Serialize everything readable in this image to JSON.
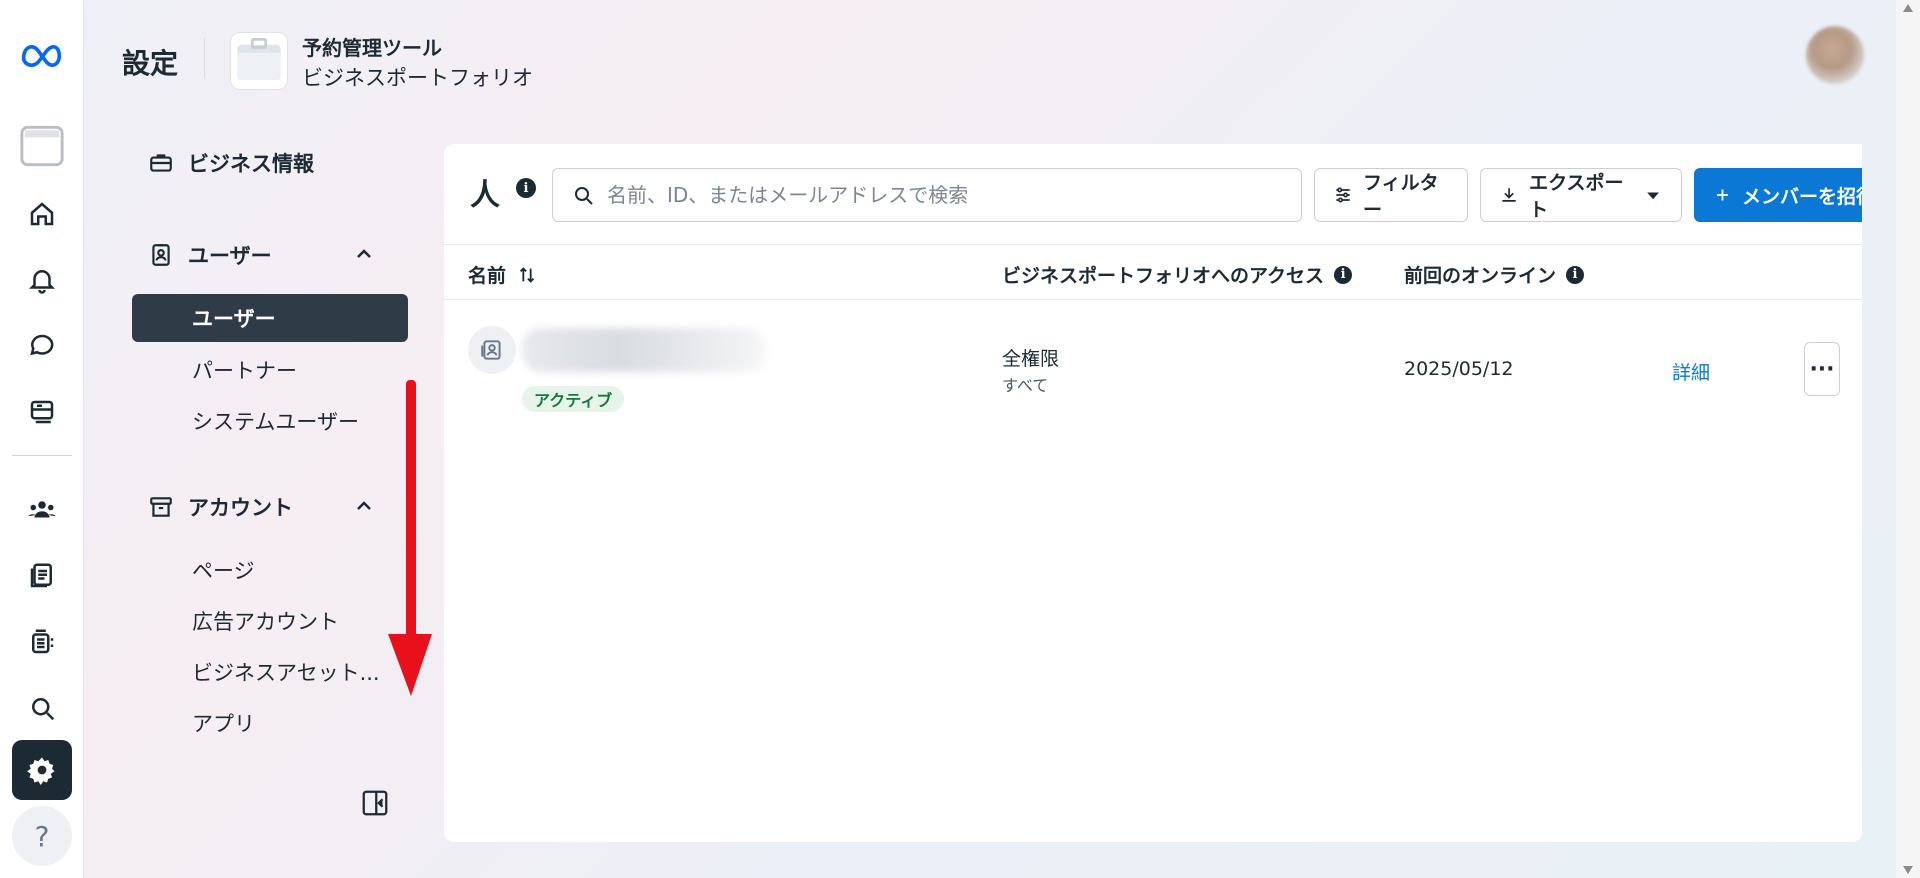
{
  "header": {
    "title": "設定",
    "portfolio_name": "予約管理ツール",
    "portfolio_sub": "ビジネスポートフォリオ"
  },
  "rail": {
    "icons": [
      "meta-logo-icon",
      "portfolio-icon",
      "home-icon",
      "bell-icon",
      "chat-icon",
      "inbox-icon",
      "people-icon",
      "documents-icon",
      "ads-icon",
      "search-icon",
      "settings-icon",
      "help-icon"
    ],
    "help_label": "?"
  },
  "sidebar": {
    "business_info": "ビジネス情報",
    "users_section": "ユーザー",
    "users_items": [
      "ユーザー",
      "パートナー",
      "システムユーザー"
    ],
    "accounts_section": "アカウント",
    "accounts_items": [
      "ページ",
      "広告アカウント",
      "ビジネスアセット...",
      "アプリ"
    ]
  },
  "main": {
    "title": "人",
    "search_placeholder": "名前、ID、またはメールアドレスで検索",
    "filter_label": "フィルター",
    "export_label": "エクスポート",
    "invite_label": "メンバーを招待",
    "columns": {
      "name": "名前",
      "access": "ビジネスポートフォリオへのアクセス",
      "last_online": "前回のオンライン"
    },
    "rows": [
      {
        "status": "アクティブ",
        "access": "全権限",
        "access_sub": "すべて",
        "last_online": "2025/05/12",
        "details": "詳細"
      }
    ]
  },
  "colors": {
    "accent": "#0a78d4",
    "active_nav": "#2f3b46",
    "status_green": "#177a3c",
    "arrow": "#e8101a"
  }
}
